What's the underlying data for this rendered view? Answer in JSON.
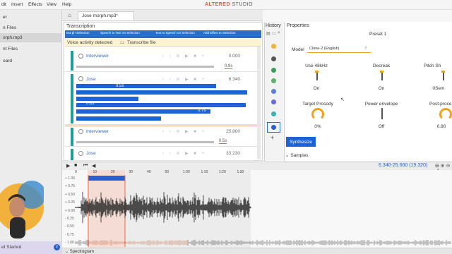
{
  "menu": {
    "items": [
      "dit",
      "Insert",
      "Effects",
      "View",
      "Help"
    ]
  },
  "sidebar": {
    "items": [
      {
        "label": "er"
      },
      {
        "label": "n Files"
      },
      {
        "label": "orph.mp3"
      },
      {
        "label": "nt Files"
      },
      {
        "label": "oard"
      }
    ],
    "get_started": "et Started",
    "badge": "2"
  },
  "tabs": {
    "file_tab": "Jose morph.mp3*"
  },
  "brand": {
    "part1": "ALTERED",
    "part2": "STUDIO"
  },
  "transcription": {
    "title": "Transcription",
    "toolbar": [
      "Morph Selection",
      "Speech to Text on Selection",
      "Text to Speech on Selection",
      "Add Effect to Selection"
    ],
    "vad_label": "Voice activity detected",
    "transcribe_button": "Transcribe file",
    "segments": [
      {
        "speaker": "Interviewer",
        "time": "0.000",
        "duration": "0.9s"
      },
      {
        "speaker": "Jose",
        "time": "6.340",
        "durations": [
          "0.5s",
          "0.8s",
          "0.7s"
        ]
      },
      {
        "speaker": "Interviewer",
        "time": "25.800",
        "duration": "0.5s"
      },
      {
        "speaker": "Jose",
        "time": "33.230"
      }
    ]
  },
  "history": {
    "title": "History"
  },
  "properties": {
    "title": "Properties",
    "preset": "Preset 1",
    "model_label": "Model",
    "model_value": "Clone-2 (English)",
    "params": [
      {
        "label": "Use 48kHz",
        "value": "On"
      },
      {
        "label": "Decreak",
        "value": "On"
      },
      {
        "label": "Pitch Sh",
        "value": "0Sem"
      },
      {
        "label": "Target Prosody",
        "value": "0%"
      },
      {
        "label": "Power envelope",
        "value": "Off"
      },
      {
        "label": "Post-proce",
        "value": "0.80"
      }
    ],
    "synthesize_button": "Synthesize",
    "samples_label": "Samples"
  },
  "timeline": {
    "range": "6.340-25.660 (19.320)",
    "ticks": [
      "0",
      "10",
      "20",
      "30",
      "40",
      "50",
      "1:00",
      "1:10",
      "1:20",
      "1:30"
    ],
    "db_labels": [
      "+ 1.00",
      "+ 0.75",
      "+ 0.50",
      "+ 0.25",
      "+ 0.00",
      "- 0.25",
      "- 0.50",
      "- 0.75",
      "- 1.00"
    ]
  },
  "spectrogram_label": "Spectrogram"
}
